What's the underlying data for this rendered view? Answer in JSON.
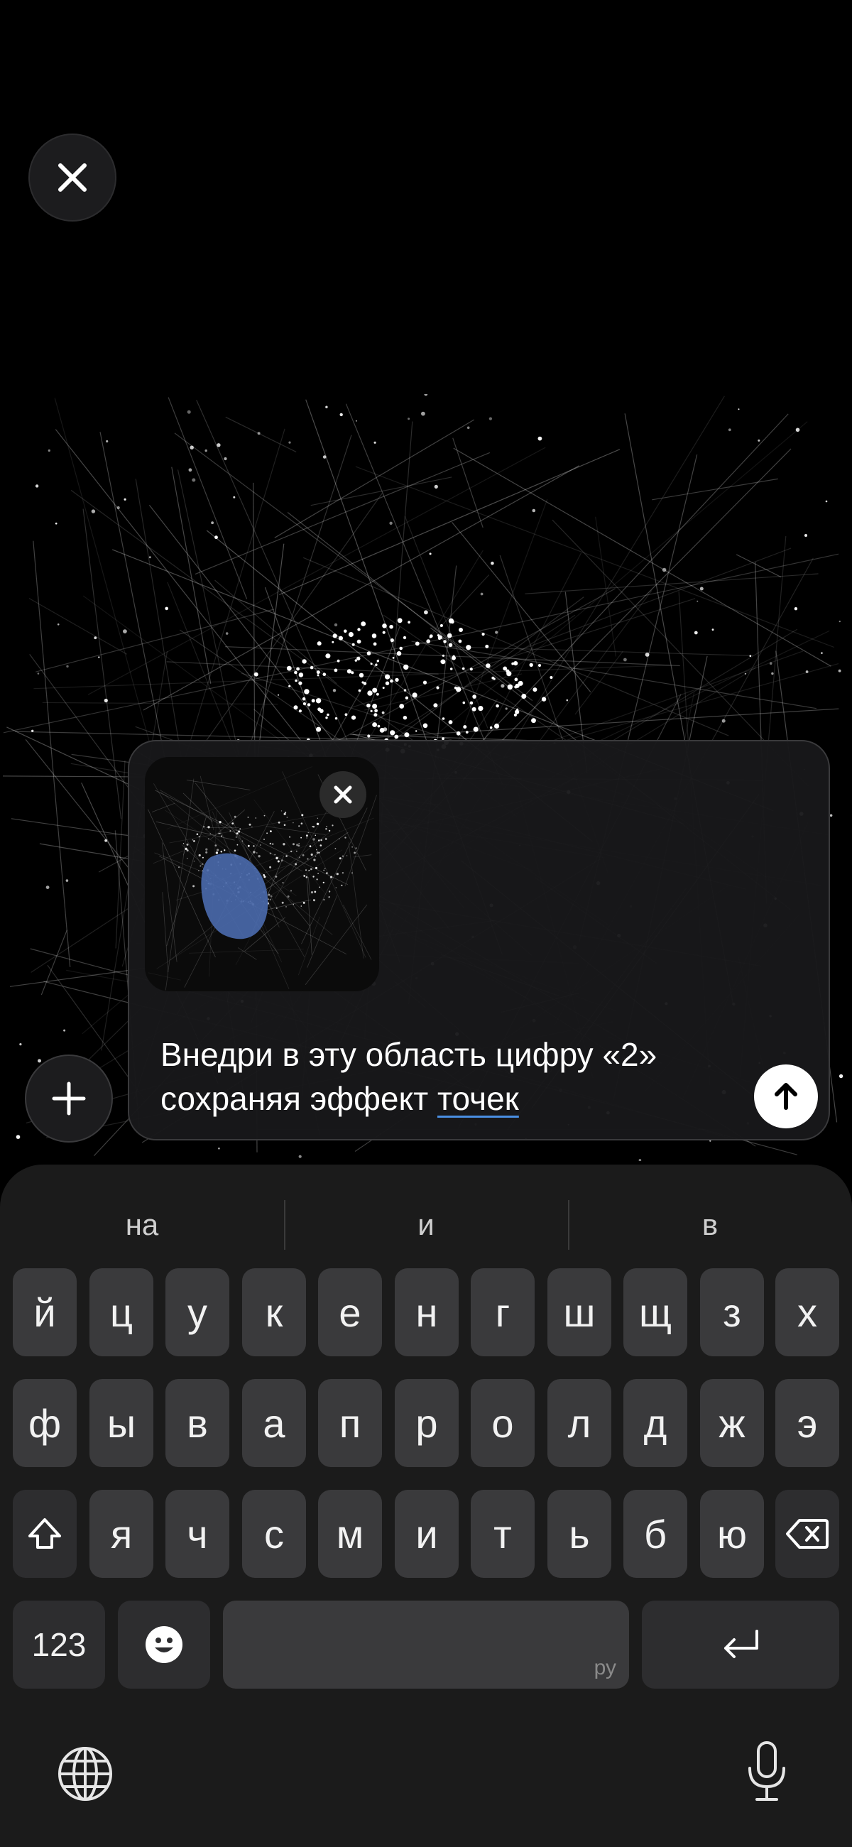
{
  "top": {
    "close_icon": "close-icon"
  },
  "composer": {
    "thumbnail_remove_icon": "close-icon",
    "prompt_line1": "Внедри в эту область цифру «2»",
    "prompt_line2_plain": "сохраняя эффект ",
    "prompt_line2_underlined": "точек",
    "send_icon": "arrow-up-icon",
    "add_icon": "plus-icon"
  },
  "keyboard": {
    "suggestions": [
      "на",
      "и",
      "в"
    ],
    "row1": [
      "й",
      "ц",
      "у",
      "к",
      "е",
      "н",
      "г",
      "ш",
      "щ",
      "з",
      "х"
    ],
    "row2": [
      "ф",
      "ы",
      "в",
      "а",
      "п",
      "р",
      "о",
      "л",
      "д",
      "ж",
      "э"
    ],
    "row3": [
      "я",
      "ч",
      "с",
      "м",
      "и",
      "т",
      "ь",
      "б",
      "ю"
    ],
    "numbers_label": "123",
    "space_lang_hint": "ру",
    "emoji_icon": "emoji-icon",
    "shift_icon": "shift-icon",
    "backspace_icon": "backspace-icon",
    "return_icon": "return-icon",
    "globe_icon": "globe-icon",
    "mic_icon": "microphone-icon"
  }
}
